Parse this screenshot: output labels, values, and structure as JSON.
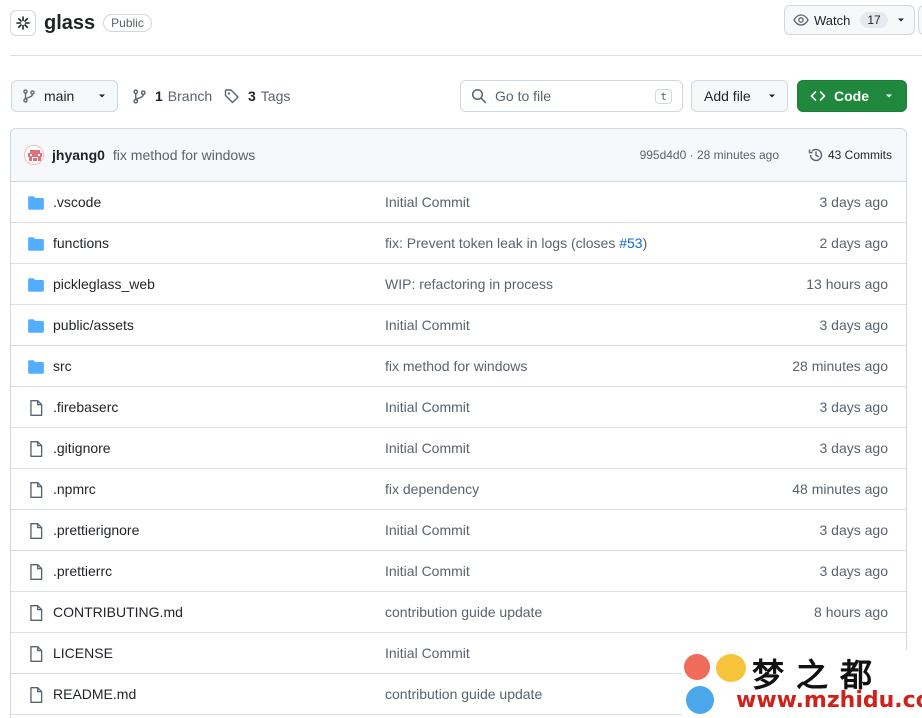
{
  "repo": {
    "name": "glass",
    "visibility": "Public",
    "watch_label": "Watch",
    "watch_count": "17"
  },
  "toolbar": {
    "branch": "main",
    "branches_count": "1",
    "branches_label": "Branch",
    "tags_count": "3",
    "tags_label": "Tags",
    "search_placeholder": "Go to file",
    "search_shortcut": "t",
    "add_file_label": "Add file",
    "code_label": "Code"
  },
  "latest_commit": {
    "author": "jhyang0",
    "message": "fix method for windows",
    "meta": "995d4d0 · 28 minutes ago",
    "commits_label": "43 Commits"
  },
  "files": [
    {
      "name": ".vscode",
      "type": "dir",
      "message": "Initial Commit",
      "age": "3 days ago"
    },
    {
      "name": "functions",
      "type": "dir",
      "message": "fix: Prevent token leak in logs (closes ",
      "issue": "#53",
      "message_end": ")",
      "age": "2 days ago"
    },
    {
      "name": "pickleglass_web",
      "type": "dir",
      "message": "WIP: refactoring in process",
      "age": "13 hours ago"
    },
    {
      "name": "public/assets",
      "type": "dir",
      "message": "Initial Commit",
      "age": "3 days ago"
    },
    {
      "name": "src",
      "type": "dir",
      "message": "fix method for windows",
      "age": "28 minutes ago"
    },
    {
      "name": ".firebaserc",
      "type": "file",
      "message": "Initial Commit",
      "age": "3 days ago"
    },
    {
      "name": ".gitignore",
      "type": "file",
      "message": "Initial Commit",
      "age": "3 days ago"
    },
    {
      "name": ".npmrc",
      "type": "file",
      "message": "fix dependency",
      "age": "48 minutes ago"
    },
    {
      "name": ".prettierignore",
      "type": "file",
      "message": "Initial Commit",
      "age": "3 days ago"
    },
    {
      "name": ".prettierrc",
      "type": "file",
      "message": "Initial Commit",
      "age": "3 days ago"
    },
    {
      "name": "CONTRIBUTING.md",
      "type": "file",
      "message": "contribution guide update",
      "age": "8 hours ago"
    },
    {
      "name": "LICENSE",
      "type": "file",
      "message": "Initial Commit",
      "age": ""
    },
    {
      "name": "README.md",
      "type": "file",
      "message": "contribution guide update",
      "age": ""
    }
  ],
  "watermark": {
    "chinese": "梦之都",
    "url": "www.mzhidu.com"
  },
  "colors": {
    "folder": "#54aeff",
    "code_button": "#1f883d",
    "link": "#0969da"
  }
}
